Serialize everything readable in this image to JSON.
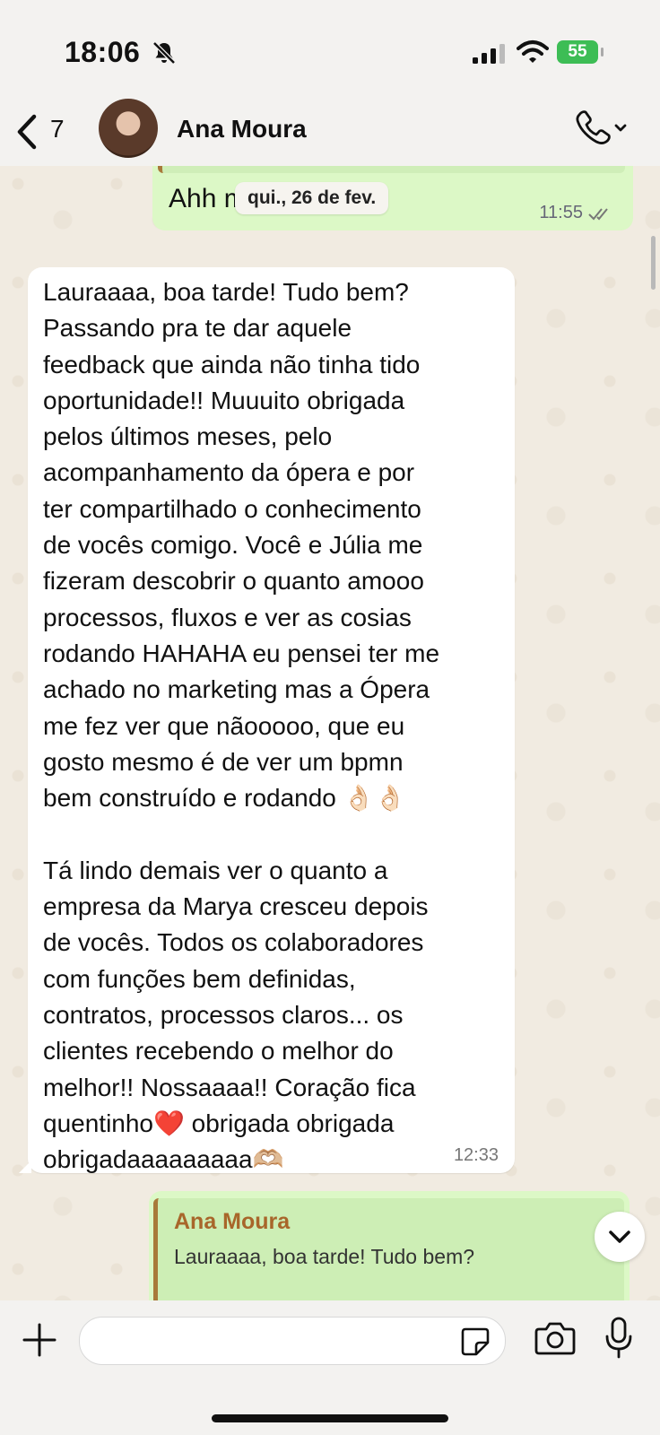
{
  "status_bar": {
    "time": "18:06",
    "battery": "55"
  },
  "header": {
    "unread_count": "7",
    "contact_name": "Ana Moura"
  },
  "chat": {
    "date_chip": "qui., 26 de fev.",
    "outgoing_top": {
      "text": "Ahh menos mal!",
      "time": "11:55"
    },
    "incoming_message": {
      "text": "Lauraaaa, boa tarde! Tudo bem?\nPassando pra te dar aquele\nfeedback que ainda não tinha tido\noportunidade!! Muuuito obrigada\npelos últimos meses, pelo\nacompanhamento da ópera e por\nter compartilhado o conhecimento\nde vocês comigo. Você e Júlia me\nfizeram descobrir o quanto amooo\nprocessos, fluxos e ver as cosias\nrodando HAHAHA eu pensei ter me\nachado no marketing mas a Ópera\nme fez ver que nãooooo, que eu\ngosto mesmo é de ver um bpmn\nbem construído e rodando 👌🏻👌🏻\n\nTá lindo demais ver o quanto a\nempresa da Marya cresceu depois\nde vocês. Todos os colaboradores\ncom funções bem definidas,\ncontratos, processos claros... os\nclientes recebendo o melhor do\nmelhor!! Nossaaaa!! Coração fica\nquentinho❤️ obrigada obrigada\nobrigadaaaaaaaaa🫶🏼",
      "time": "12:33"
    },
    "reply_message": {
      "quoted_name": "Ana Moura",
      "quoted_text": "Lauraaaa, boa tarde! Tudo bem?"
    }
  },
  "composer": {
    "placeholder": ""
  },
  "colors": {
    "outgoing_bubble": "#dcf8c6",
    "incoming_bubble": "#ffffff",
    "quote_accent": "#a8793a",
    "battery": "#3dbd55"
  },
  "icons": [
    "bell-slash-icon",
    "signal-icon",
    "wifi-icon",
    "back-chevron-icon",
    "phone-icon",
    "chevron-down-icon",
    "double-check-icon",
    "plus-icon",
    "sticker-icon",
    "camera-icon",
    "microphone-icon"
  ]
}
